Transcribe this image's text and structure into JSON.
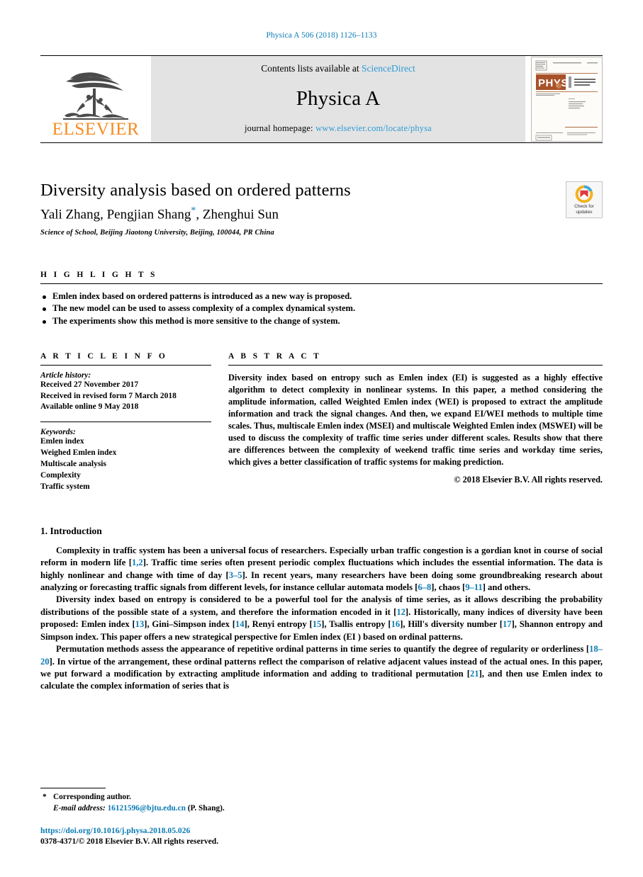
{
  "running_head": "Physica A 506 (2018) 1126–1133",
  "masthead": {
    "publisher": "ELSEVIER",
    "contents_prefix": "Contents lists available at",
    "sciencedirect": "ScienceDirect",
    "journal_title": "Physica A",
    "homepage_prefix": "journal homepage:",
    "homepage_url": "www.elsevier.com/locate/physa",
    "cover_brand": "PHYSICA",
    "cover_subtitle": "STATISTICAL MECHANICS AND ITS APPLICATIONS"
  },
  "article": {
    "title": "Diversity analysis based on ordered patterns",
    "authors_part1": "Yali Zhang, Pengjian Shang",
    "corresponding_marker": "*",
    "authors_part2": ", Zhenghui Sun",
    "affiliation": "Science of School, Beijing Jiaotong University, Beijing, 100044, PR China",
    "crossmark_line1": "Check for",
    "crossmark_line2": "updates"
  },
  "highlights": {
    "label": "H I G H L I G H T S",
    "items": [
      "Emlen index based on ordered patterns is introduced as a new way is proposed.",
      "The new model can be used to assess complexity of a complex dynamical system.",
      "The experiments show this method is more sensitive to the change of system."
    ]
  },
  "article_info": {
    "label": "A R T I C L E    I N F O",
    "history_label": "Article history:",
    "history": [
      "Received 27 November 2017",
      "Received in revised form 7 March 2018",
      "Available online 9 May 2018"
    ],
    "keywords_label": "Keywords:",
    "keywords": [
      "Emlen index",
      "Weighed Emlen index",
      "Multiscale analysis",
      "Complexity",
      "Traffic system"
    ]
  },
  "abstract": {
    "label": "A B S T R A C T",
    "text": "Diversity index based on entropy such as Emlen index (EI) is suggested as a highly effective algorithm to detect complexity in nonlinear systems. In this paper, a method considering the amplitude information, called Weighted Emlen index (WEI) is proposed to extract the amplitude information and track the signal changes. And then, we expand EI/WEI methods to multiple time scales. Thus, multiscale Emlen index (MSEI) and multiscale Weighted Emlen index (MSWEI) will be used to discuss the complexity of traffic time series under different scales. Results show that there are differences between the complexity of weekend traffic time series and workday time series, which gives a better classification of traffic systems for making prediction.",
    "copyright": "© 2018 Elsevier B.V. All rights reserved."
  },
  "introduction": {
    "heading": "1. Introduction",
    "paragraph1_a": "Complexity in traffic system has been a universal focus of researchers. Especially urban traffic congestion is a gordian knot in course of social reform in modern life [",
    "p1_ref1": "1,2",
    "paragraph1_b": "]. Traffic time series often present periodic complex fluctuations which includes the essential information. The data is highly nonlinear and change with time of day [",
    "p1_ref2": "3–5",
    "paragraph1_c": "]. In recent years, many researchers have been doing some groundbreaking research about analyzing or forecasting traffic signals from different levels, for instance cellular automata models [",
    "p1_ref3": "6–8",
    "paragraph1_d": "], chaos [",
    "p1_ref4": "9–11",
    "paragraph1_e": "] and others.",
    "paragraph2_a": "Diversity index based on entropy is considered to be a powerful tool for the analysis of time series, as it allows describing the probability distributions of the possible state of a system, and therefore the information encoded in it [",
    "p2_ref1": "12",
    "paragraph2_b": "]. Historically, many indices of diversity have been proposed: Emlen index [",
    "p2_ref2": "13",
    "paragraph2_c": "], Gini–Simpson index [",
    "p2_ref3": "14",
    "paragraph2_d": "], Renyi entropy [",
    "p2_ref4": "15",
    "paragraph2_e": "], Tsallis entropy [",
    "p2_ref5": "16",
    "paragraph2_f": "], Hill's diversity number [",
    "p2_ref6": "17",
    "paragraph2_g": "], Shannon entropy and Simpson index. This paper offers a new strategical perspective for Emlen index (EI ) based on ordinal patterns.",
    "paragraph3_a": "Permutation methods assess the appearance of repetitive ordinal patterns in time series to quantify the degree of regularity or orderliness [",
    "p3_ref1": "18–20",
    "paragraph3_b": "]. In virtue of the arrangement, these ordinal patterns reflect the comparison of relative adjacent values instead of the actual ones. In this paper, we put forward a modification by extracting amplitude information and adding to traditional permutation [",
    "p3_ref2": "21",
    "paragraph3_c": "], and then use Emlen index to calculate the complex information of series that is"
  },
  "footer": {
    "corresponding_star": "*",
    "corresponding_author": "Corresponding author.",
    "email_label": "E-mail address:",
    "email": "16121596@bjtu.edu.cn",
    "email_owner": "(P. Shang).",
    "doi": "https://doi.org/10.1016/j.physa.2018.05.026",
    "issn": "0378-4371/© 2018 Elsevier B.V. All rights reserved."
  },
  "colors": {
    "link_blue": "#0b7bb5",
    "sciencedirect_blue": "#2e9bd6",
    "elsevier_orange": "#f68b1f"
  }
}
